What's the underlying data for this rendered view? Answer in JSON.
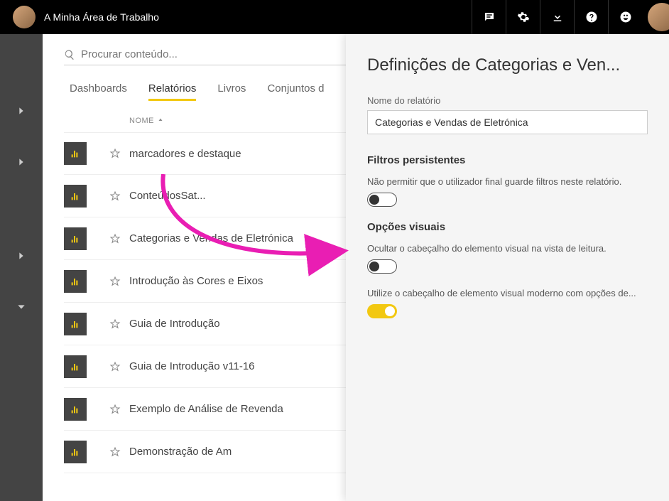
{
  "header": {
    "workspace": "A Minha Área de Trabalho"
  },
  "search": {
    "placeholder": "Procurar conteúdo..."
  },
  "tabs": [
    {
      "label": "Dashboards"
    },
    {
      "label": "Relatórios"
    },
    {
      "label": "Livros"
    },
    {
      "label": "Conjuntos d"
    }
  ],
  "columns": {
    "name": "NOME"
  },
  "reports": [
    {
      "name": "marcadores e destaque"
    },
    {
      "name": "ConteúdosSat..."
    },
    {
      "name": "Categorias e Vendas de Eletrónica"
    },
    {
      "name": "Introdução às Cores e Eixos"
    },
    {
      "name": "Guia de Introdução"
    },
    {
      "name": "Guia de Introdução v11-16"
    },
    {
      "name": "Exemplo de Análise de Revenda"
    },
    {
      "name": "Demonstração de Am"
    }
  ],
  "panel": {
    "title": "Definições de Categorias e Ven...",
    "name_label": "Nome do relatório",
    "name_value": "Categorias e Vendas de Eletrónica",
    "section_filters": "Filtros persistentes",
    "filter_desc": "Não permitir que o utilizador final guarde filtros neste relatório.",
    "section_visual": "Opções visuais",
    "visual_desc1": "Ocultar o cabeçalho do elemento visual na vista de leitura.",
    "visual_desc2": "Utilize o cabeçalho de elemento visual moderno com opções de..."
  }
}
